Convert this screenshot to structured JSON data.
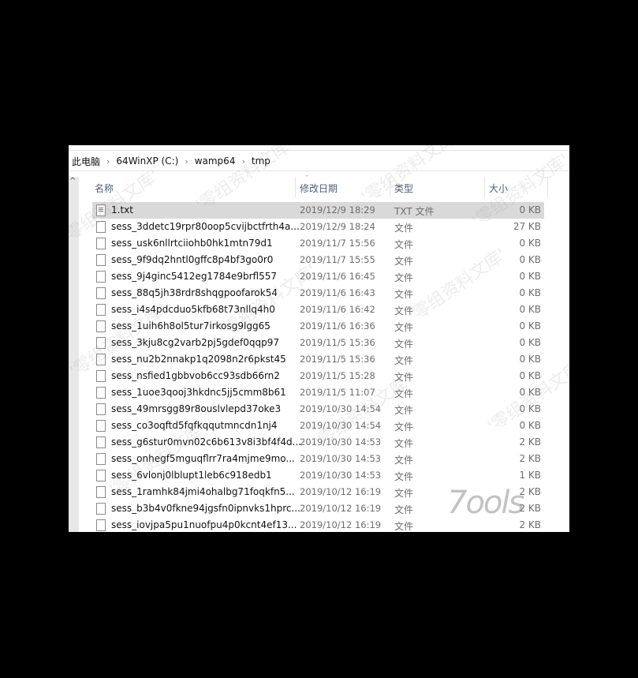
{
  "breadcrumb": [
    "此电脑",
    "64WinXP  (C:)",
    "wamp64",
    "tmp"
  ],
  "columns": {
    "name": "名称",
    "date": "修改日期",
    "type": "类型",
    "size": "大小"
  },
  "files": [
    {
      "name": "1.txt",
      "date": "2019/12/9 18:29",
      "type": "TXT 文件",
      "size": "0 KB",
      "icon": "text-file-icon",
      "selected": true
    },
    {
      "name": "sess_3ddetc19rpr80oop5cvijbctfrth4a...",
      "date": "2019/12/9 18:24",
      "type": "文件",
      "size": "27 KB"
    },
    {
      "name": "sess_usk6nllrtciiohb0hk1mtn79d1",
      "date": "2019/11/7 15:56",
      "type": "文件",
      "size": "0 KB"
    },
    {
      "name": "sess_9f9dq2hntl0gffc8p4bf3go0r0",
      "date": "2019/11/7 15:55",
      "type": "文件",
      "size": "0 KB"
    },
    {
      "name": "sess_9j4ginc5412eg1784e9brfl557",
      "date": "2019/11/6 16:45",
      "type": "文件",
      "size": "0 KB"
    },
    {
      "name": "sess_88q5jh38rdr8shqgpoofarok54",
      "date": "2019/11/6 16:43",
      "type": "文件",
      "size": "0 KB"
    },
    {
      "name": "sess_i4s4pdcduo5kfb68t73nllq4h0",
      "date": "2019/11/6 16:42",
      "type": "文件",
      "size": "0 KB"
    },
    {
      "name": "sess_1uih6h8ol5tur7irkosg9lgg65",
      "date": "2019/11/6 16:36",
      "type": "文件",
      "size": "0 KB"
    },
    {
      "name": "sess_3kju8cg2varb2pj5gdef0qqp97",
      "date": "2019/11/5 15:36",
      "type": "文件",
      "size": "0 KB"
    },
    {
      "name": "sess_nu2b2nnakp1q2098n2r6pkst45",
      "date": "2019/11/5 15:36",
      "type": "文件",
      "size": "0 KB"
    },
    {
      "name": "sess_nsfied1gbbvob6cc93sdb66rn2",
      "date": "2019/11/5 15:28",
      "type": "文件",
      "size": "0 KB"
    },
    {
      "name": "sess_1uoe3qooj3hkdnc5jj5cmm8b61",
      "date": "2019/11/5 11:07",
      "type": "文件",
      "size": "0 KB"
    },
    {
      "name": "sess_49mrsgg89r8ouslvlepd37oke3",
      "date": "2019/10/30 14:54",
      "type": "文件",
      "size": "0 KB"
    },
    {
      "name": "sess_co3oqftd5fqfkqqutmncdn1nj4",
      "date": "2019/10/30 14:54",
      "type": "文件",
      "size": "0 KB"
    },
    {
      "name": "sess_g6stur0mvn02c6b613v8i3bf4f4d...",
      "date": "2019/10/30 14:53",
      "type": "文件",
      "size": "2 KB"
    },
    {
      "name": "sess_onhegf5mguqflrr7ra4mjme9mo...",
      "date": "2019/10/30 14:53",
      "type": "文件",
      "size": "2 KB"
    },
    {
      "name": "sess_6vlonj0lblupt1leb6c918edb1",
      "date": "2019/10/30 14:53",
      "type": "文件",
      "size": "1 KB"
    },
    {
      "name": "sess_1ramhk84jmi4ohalbg71foqkfn5...",
      "date": "2019/10/12 16:19",
      "type": "文件",
      "size": "2 KB"
    },
    {
      "name": "sess_b3b4v0fkne94jgsfn0ipnvks1hprc...",
      "date": "2019/10/12 16:19",
      "type": "文件",
      "size": "2 KB"
    },
    {
      "name": "sess_iovjpa5pu1nuofpu4p0kcnt4ef13...",
      "date": "2019/10/12 16:19",
      "type": "文件",
      "size": "2 KB"
    }
  ],
  "watermark": "'零组资料文库'",
  "logo": "7ools"
}
